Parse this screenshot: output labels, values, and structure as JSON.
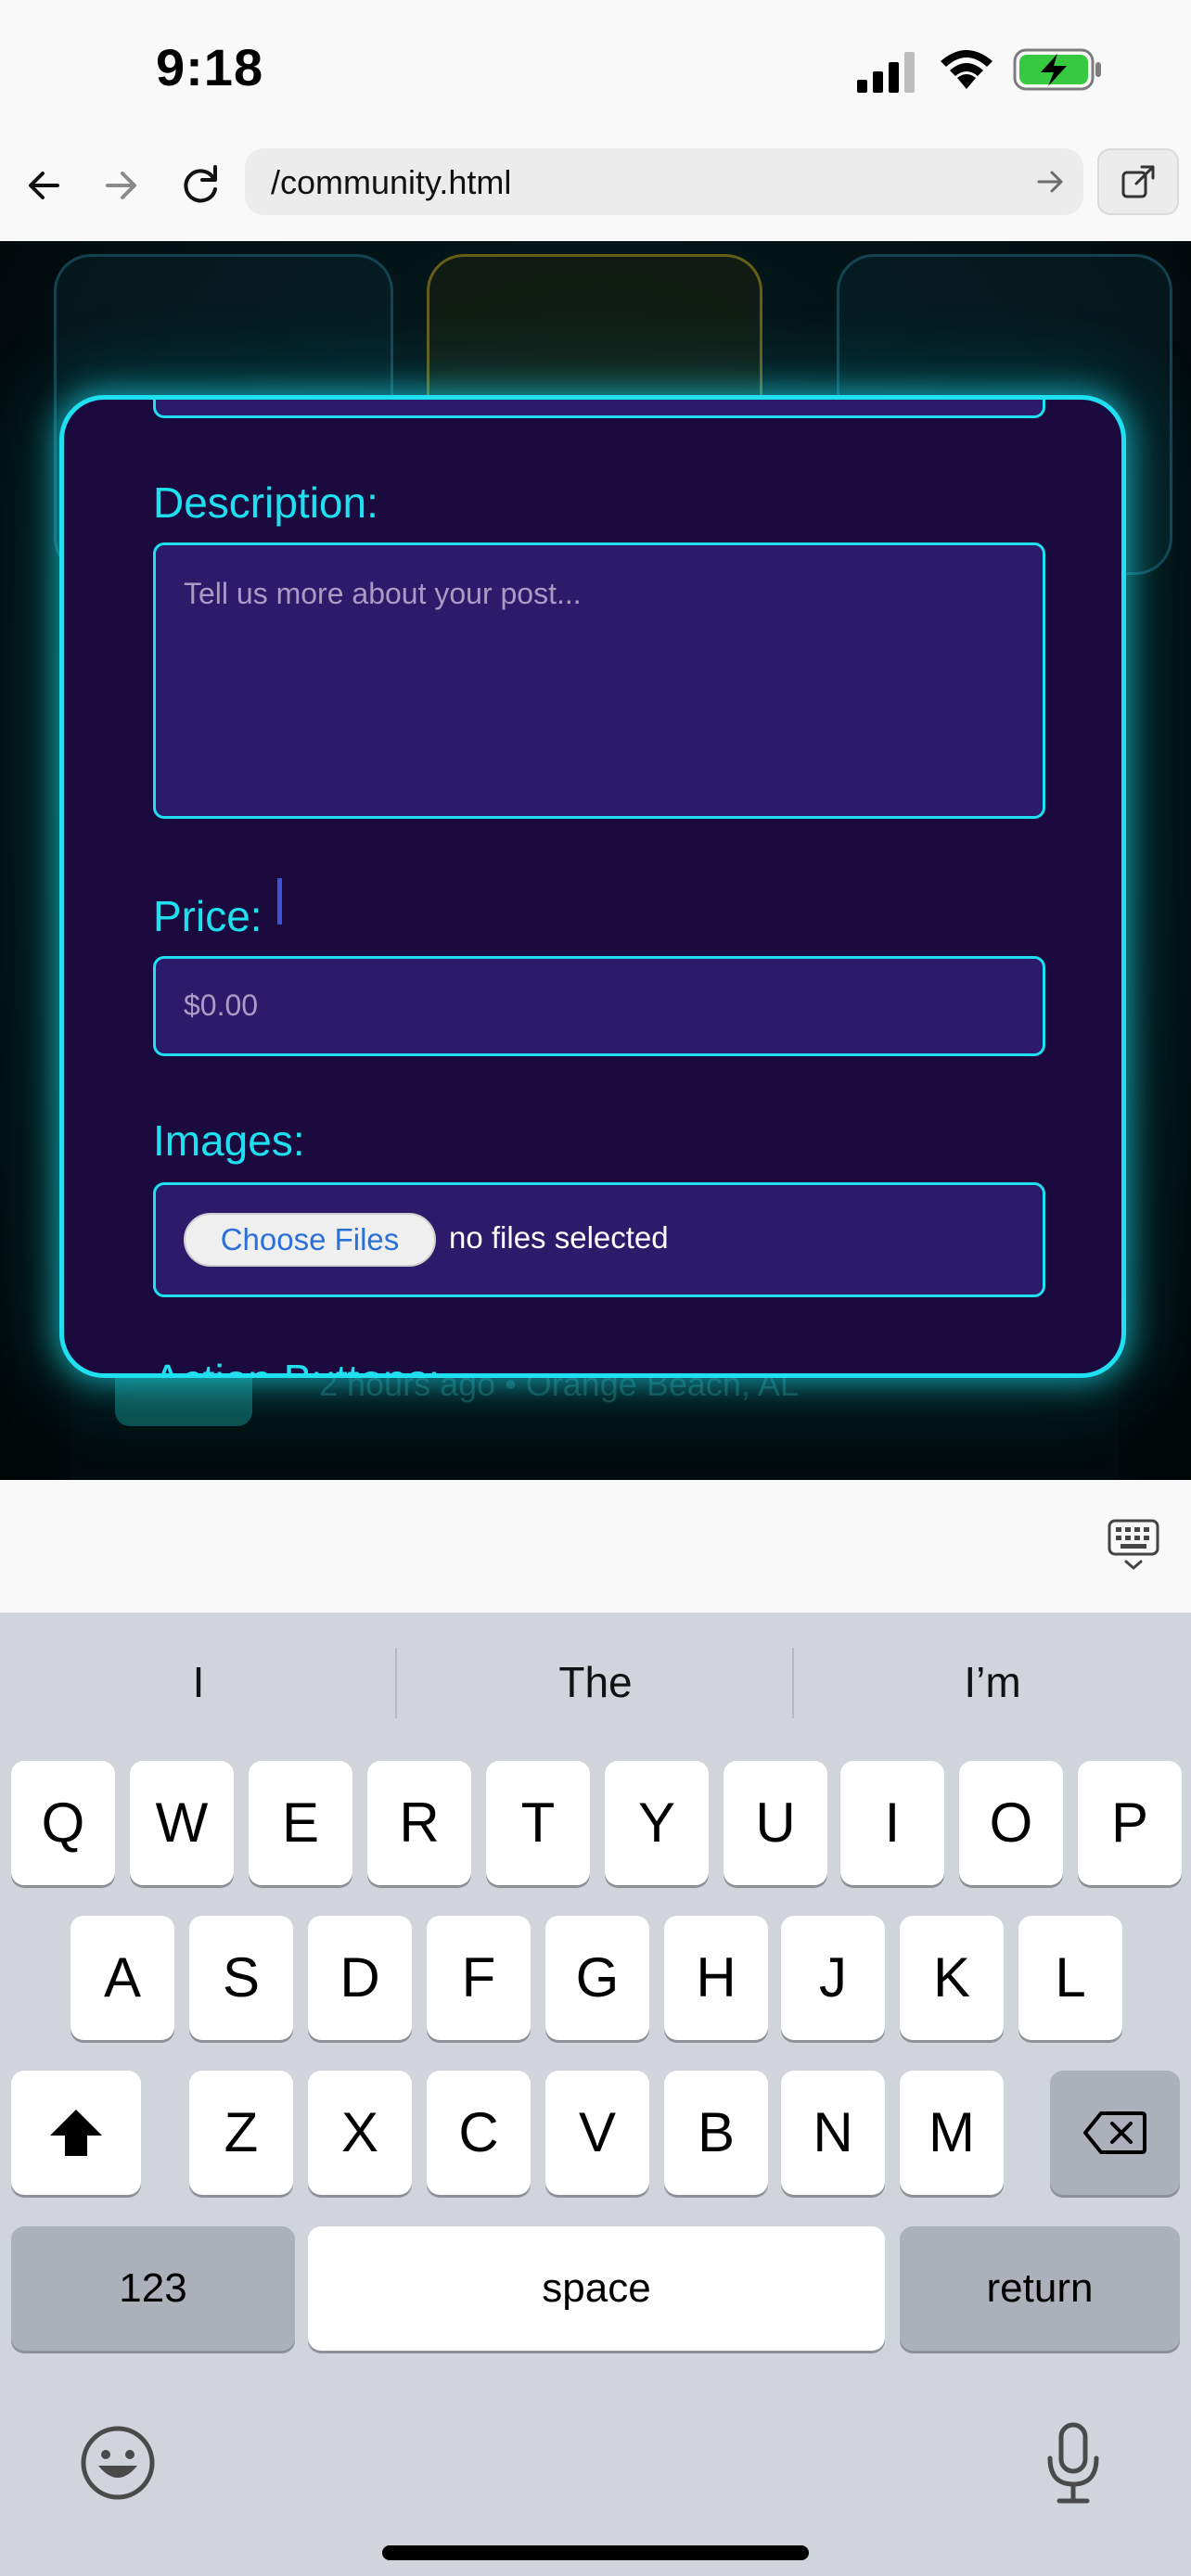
{
  "status_bar": {
    "time": "9:18",
    "battery_color": "#37c940"
  },
  "browser": {
    "url": "/community.html"
  },
  "background": {
    "listing_meta": "2 hours ago • Orange Beach, AL"
  },
  "form": {
    "description_label": "Description:",
    "description_placeholder": "Tell us more about your post...",
    "price_label": "Price:",
    "price_placeholder": "$0.00",
    "images_label": "Images:",
    "choose_files_label": "Choose Files",
    "no_files_text": "no files selected",
    "actions_label": "Action Buttons:"
  },
  "keyboard": {
    "suggestions": [
      "I",
      "The",
      "I’m"
    ],
    "row1": [
      "Q",
      "W",
      "E",
      "R",
      "T",
      "Y",
      "U",
      "I",
      "O",
      "P"
    ],
    "row2": [
      "A",
      "S",
      "D",
      "F",
      "G",
      "H",
      "J",
      "K",
      "L"
    ],
    "row3": [
      "Z",
      "X",
      "C",
      "V",
      "B",
      "N",
      "M"
    ],
    "numbers_label": "123",
    "space_label": "space",
    "return_label": "return"
  },
  "colors": {
    "accent": "#1ee0f0",
    "modal_bg": "#1b0a3d",
    "input_bg": "#2c1a6b",
    "link_blue": "#2a70d8"
  }
}
